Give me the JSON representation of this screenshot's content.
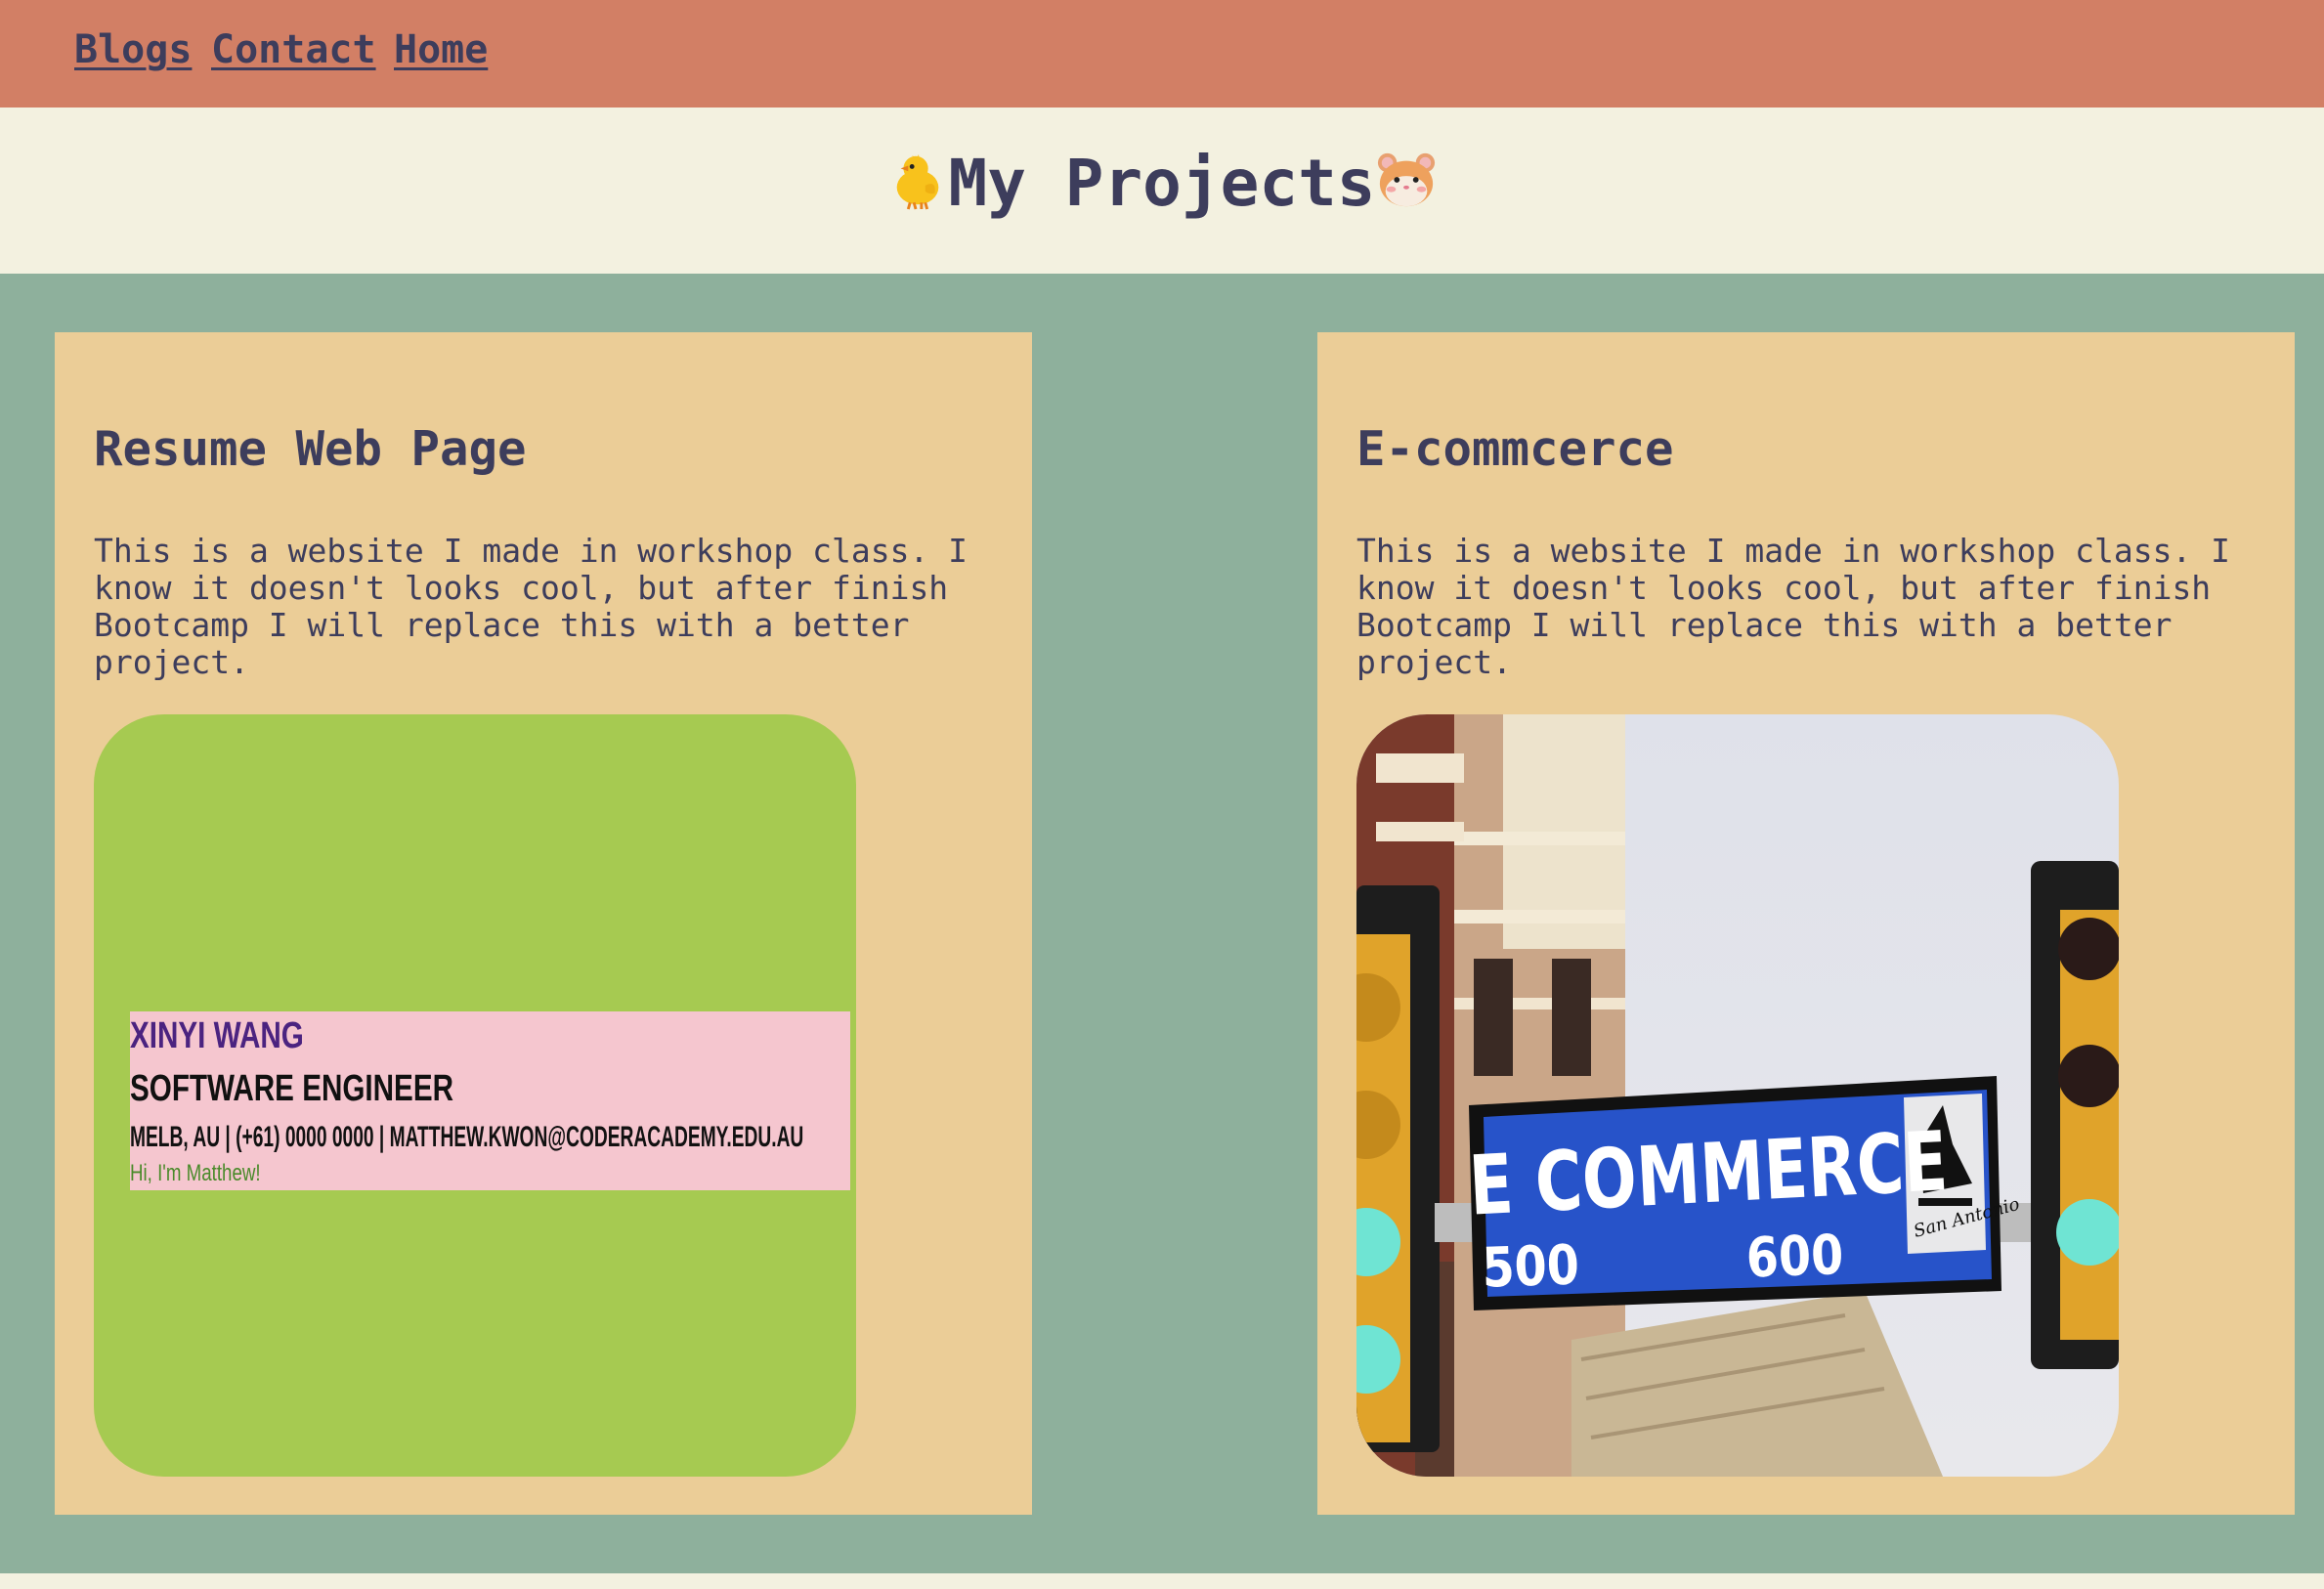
{
  "nav": {
    "links": [
      {
        "label": "Blogs"
      },
      {
        "label": "Contact"
      },
      {
        "label": "Home"
      }
    ]
  },
  "hero": {
    "title": "My Projects",
    "emoji_left": "chick-emoji-icon",
    "emoji_right": "hamster-emoji-icon"
  },
  "projects": [
    {
      "title": "Resume Web Page",
      "description": "This is a website I made in workshop class. I know it doesn't looks cool, but after finish Bootcamp I will replace this with a better project.",
      "preview": {
        "name": "XINYI WANG",
        "role": "SOFTWARE ENGINEER",
        "contact": "MELB, AU | (+61) 0000 0000 | MATTHEW.KWON@CODERACADEMY.EDU.AU",
        "greeting": "Hi, I'm Matthew!"
      }
    },
    {
      "title": "E-commcerce",
      "description": "This is a website I made in workshop class. I know it doesn't looks cool, but after finish Bootcamp I will replace this with a better project.",
      "preview": {
        "sign_text": "E COMMERCE",
        "sign_left_number": "500",
        "sign_right_number": "600",
        "logo_text": "San Antonio"
      }
    }
  ],
  "colors": {
    "nav_bg": "#d27f65",
    "hero_bg": "#f3f1e0",
    "main_bg": "#8eb09c",
    "card_bg": "#ebcd97",
    "text": "#3d3d5c"
  }
}
